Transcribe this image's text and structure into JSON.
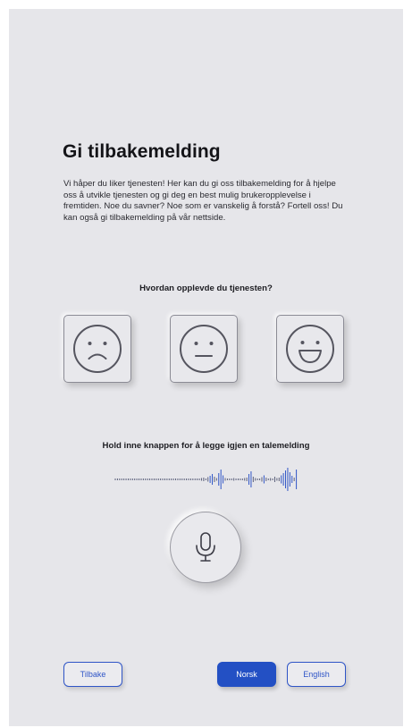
{
  "header": {
    "title": "Gi tilbakemelding",
    "intro": "Vi håper du liker tjenesten! Her kan du gi oss tilbakemelding for å hjelpe oss å utvikle tjenesten og gi deg en best mulig brukeropplevelse i fremtiden. Noe du savner? Noe som er vanskelig å forstå? Fortell oss! Du kan også gi tilbakemelding på vår nettside."
  },
  "rating": {
    "question": "Hvordan opplevde du tjenesten?",
    "options": [
      {
        "icon": "sad-face-icon"
      },
      {
        "icon": "neutral-face-icon"
      },
      {
        "icon": "happy-face-icon"
      }
    ]
  },
  "voice": {
    "label": "Hold inne knappen for å legge igjen en talemelding",
    "icon": "microphone-icon",
    "waveform_colors": {
      "quiet": "#5a5f7a",
      "loud": "#2f55c7"
    }
  },
  "footer": {
    "back_label": "Tilbake",
    "norsk_label": "Norsk",
    "english_label": "English"
  },
  "colors": {
    "accent": "#2350c4",
    "background": "#e6e6ea",
    "icon_stroke": "#55555f"
  }
}
